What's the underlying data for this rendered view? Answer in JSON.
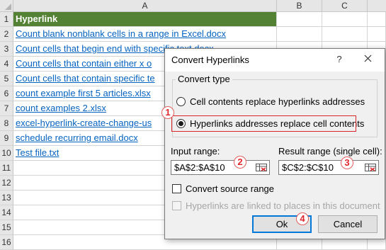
{
  "spreadsheet": {
    "columns": [
      "A",
      "B",
      "C"
    ],
    "rows": [
      "1",
      "2",
      "3",
      "4",
      "5",
      "6",
      "7",
      "8",
      "9",
      "10",
      "11",
      "12",
      "13",
      "14",
      "15",
      "16"
    ],
    "header_cell": "Hyperlink",
    "cells": [
      "Count blank nonblank cells in a range in Excel.docx",
      "Count cells that begin end with specific text.docx",
      "Count cells that contain either x o",
      "Count cells that contain specific te",
      "count example first 5 articles.xlsx",
      "count examples 2.xlsx",
      "excel-hyperlink-create-change-us",
      "schedule recurring email.docx",
      "Test file.txt"
    ],
    "header_color": "#548235",
    "link_color": "#0563c1"
  },
  "dialog": {
    "title": "Convert Hyperlinks",
    "help_label": "?",
    "close_icon": "close-icon",
    "convert_type_legend": "Convert type",
    "option_1": "Cell contents replace hyperlinks addresses",
    "option_2": "Hyperlinks addresses replace cell contents",
    "selected_option": 2,
    "input_range_label": "Input range:",
    "input_range_value": "$A$2:$A$10",
    "result_range_label": "Result range (single cell):",
    "result_range_value": "$C$2:$C$10",
    "convert_source_label": "Convert source range",
    "linked_places_label": "Hyperlinks are linked to places in this document",
    "ok_label": "Ok",
    "cancel_label": "Cancel"
  },
  "steps": [
    "1",
    "2",
    "3",
    "4"
  ],
  "accent_color": "#e0262b"
}
